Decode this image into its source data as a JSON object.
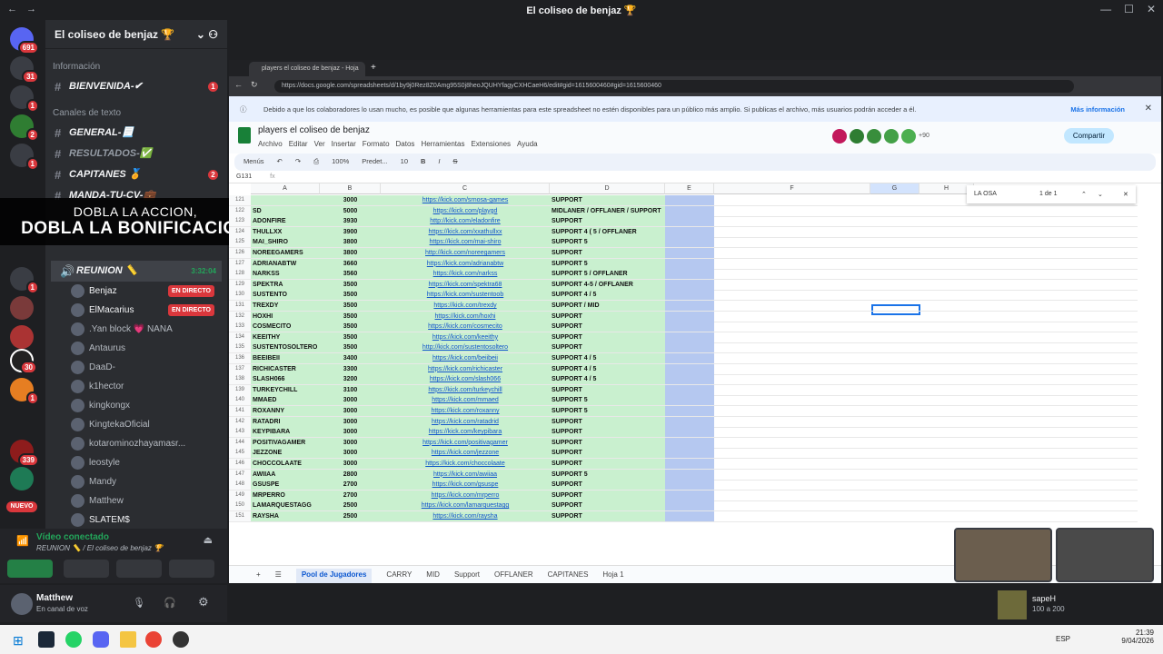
{
  "window": {
    "title": "El coliseo de benjaz 🏆"
  },
  "servers": {
    "badges": [
      "691",
      "31",
      "1",
      "2",
      "1",
      "1",
      "339",
      "30",
      "1"
    ],
    "new_label": "NUEVO"
  },
  "server": {
    "name": "El coliseo de benjaz 🏆"
  },
  "channels": {
    "cat_info": "Información",
    "cat_text": "Canales de texto",
    "info": [
      {
        "name": "BIENVENIDA-✔",
        "badge": "1"
      }
    ],
    "text": [
      {
        "name": "GENERAL-📃",
        "badge": ""
      },
      {
        "name": "RESULTADOS-✅",
        "badge": ""
      },
      {
        "name": "CAPITANES 🏅",
        "badge": "2"
      },
      {
        "name": "MANDA-TU-CV-💼",
        "badge": ""
      }
    ],
    "voice": {
      "name": "REUNION 📏",
      "time": "3:32:04"
    },
    "members": [
      {
        "name": "Benjaz",
        "live": "EN DIRECTO"
      },
      {
        "name": "ElMacarius",
        "live": "EN DIRECTO"
      },
      {
        "name": ".Yan block 💗 NANA",
        "live": ""
      },
      {
        "name": "Antaurus",
        "live": ""
      },
      {
        "name": "DaaD-",
        "live": ""
      },
      {
        "name": "k1hector",
        "live": ""
      },
      {
        "name": "kingkongx",
        "live": ""
      },
      {
        "name": "KingtekaOficial",
        "live": ""
      },
      {
        "name": "kotarominozhayamasr...",
        "live": ""
      },
      {
        "name": "leostyle",
        "live": ""
      },
      {
        "name": "Mandy",
        "live": ""
      },
      {
        "name": "Matthew",
        "live": ""
      },
      {
        "name": "SLATEM$",
        "live": ""
      }
    ]
  },
  "promo": {
    "line1": "DOBLA LA ACCION,",
    "line2": "DOBLA LA BONIFICACION"
  },
  "voice_status": {
    "title": "Vídeo conectado",
    "subtitle": "REUNION 📏 / El coliseo de benjaz 🏆"
  },
  "user": {
    "name": "Matthew",
    "status": "En canal de voz"
  },
  "browser": {
    "tab": "players el coliseo de benjaz - Hoja",
    "url": "https://docs.google.com/spreadsheets/d/1by9j0Rez8Z0Amg95S0j8heoJQUHYfagyCXHCaeH6/edit#gid=1615600460#gid=1615600460",
    "notice": "Debido a que los colaboradores lo usan mucho, es posible que algunas herramientas para este spreadsheet no estén disponibles para un público más amplio. Si publicas el archivo, más usuarios podrán acceder a él.",
    "notice_link": "Más información",
    "doc_title": "players el coliseo de benjaz",
    "menu": [
      "Archivo",
      "Editar",
      "Ver",
      "Insertar",
      "Formato",
      "Datos",
      "Herramientas",
      "Extensiones",
      "Ayuda"
    ],
    "share": "Compartir",
    "collab_count": "+90",
    "toolbar": {
      "menus": "Menús",
      "zoom": "100%",
      "font": "Predet...",
      "size": "10"
    },
    "cell_ref": "G131",
    "find": {
      "query": "LA OSA",
      "count": "1 de 1"
    },
    "columns": [
      "A",
      "B",
      "C",
      "D",
      "E",
      "F",
      "G",
      "H"
    ],
    "sheets": [
      "Pool de Jugadores",
      "CARRY",
      "MID",
      "Support",
      "OFFLANER",
      "CAPITANES",
      "Hoja 1"
    ]
  },
  "rows": [
    [
      "121",
      "",
      "3000",
      "https://kick.com/srnosa-games",
      "SUPPORT"
    ],
    [
      "122",
      "SD",
      "5000",
      "https://kick.com/playgd",
      "MIDLANER / OFFLANER / SUPPORT"
    ],
    [
      "123",
      "ADONFIRE",
      "3930",
      "http://kick.com/eladonfire",
      "SUPPORT"
    ],
    [
      "124",
      "THULLXX",
      "3900",
      "https://kick.com/xxathullxx",
      "SUPPORT 4 ( 5 / OFFLANER"
    ],
    [
      "125",
      "MAI_SHIRO",
      "3800",
      "https://kick.com/mai-shiro",
      "SUPPORT 5"
    ],
    [
      "126",
      "NOREEGAMERS",
      "3800",
      "http://kick.com/noreegamers",
      "SUPPORT"
    ],
    [
      "127",
      "ADRIANABTW",
      "3660",
      "https://kick.com/adrianabtw",
      "SUPPORT 5"
    ],
    [
      "128",
      "NARKSS",
      "3560",
      "https://kick.com/narkss",
      "SUPPORT 5 / OFFLANER"
    ],
    [
      "129",
      "SPEKTRA",
      "3500",
      "https://kick.com/spektra68",
      "SUPPORT 4-5 / OFFLANER"
    ],
    [
      "130",
      "SUSTENTO",
      "3500",
      "https://kick.com/sustentoob",
      "SUPPORT 4 / 5"
    ],
    [
      "131",
      "TREXDY",
      "3500",
      "https://kick.com/trexdy",
      "SUPPORT / MID"
    ],
    [
      "132",
      "HOXHI",
      "3500",
      "https://kick.com/hoxhi",
      "SUPPORT"
    ],
    [
      "133",
      "COSMECITO",
      "3500",
      "https://kick.com/cosmecito",
      "SUPPORT"
    ],
    [
      "134",
      "KEEITHY",
      "3500",
      "https://kick.com/keeithy",
      "SUPPORT"
    ],
    [
      "135",
      "SUSTENTOSOLTERO",
      "3500",
      "http://kick.com/sustentosoltero",
      "SUPPORT"
    ],
    [
      "136",
      "BEEIBEII",
      "3400",
      "https://kick.com/beiibeii",
      "SUPPORT 4 / 5"
    ],
    [
      "137",
      "RICHICASTER",
      "3300",
      "https://kick.com/richicaster",
      "SUPPORT 4 / 5"
    ],
    [
      "138",
      "SLASH066",
      "3200",
      "https://kick.com/slash066",
      "SUPPORT 4 / 5"
    ],
    [
      "139",
      "TURKEYCHILL",
      "3100",
      "https://kick.com/turkeychill",
      "SUPPORT"
    ],
    [
      "140",
      "MMAED",
      "3000",
      "https://kick.com/mmaed",
      "SUPPORT 5"
    ],
    [
      "141",
      "ROXANNY",
      "3000",
      "https://kick.com/roxanny",
      "SUPPORT 5"
    ],
    [
      "142",
      "RATADRI",
      "3000",
      "https://kick.com/ratadrid",
      "SUPPORT"
    ],
    [
      "143",
      "KEYPIBARA",
      "3000",
      "https://kick.com/keypibara",
      "SUPPORT"
    ],
    [
      "144",
      "POSITIVAGAMER",
      "3000",
      "https://kick.com/positivagamer",
      "SUPPORT"
    ],
    [
      "145",
      "JEZZONE",
      "3000",
      "https://kick.com/jezzone",
      "SUPPORT"
    ],
    [
      "146",
      "CHOCCOLAATE",
      "3000",
      "https://kick.com/choccolaate",
      "SUPPORT"
    ],
    [
      "147",
      "AWIIAA",
      "2800",
      "https://kick.com/awiiaa",
      "SUPPORT 5"
    ],
    [
      "148",
      "GSUSPE",
      "2700",
      "https://kick.com/gsuspe",
      "SUPPORT"
    ],
    [
      "149",
      "MRPERRO",
      "2700",
      "https://kick.com/mrperro",
      "SUPPORT"
    ],
    [
      "150",
      "LAMARQUESTAGG",
      "2500",
      "https://kick.com/lamarquestagg",
      "SUPPORT"
    ],
    [
      "151",
      "RAYSHA",
      "2500",
      "https://kick.com/raysha",
      "SUPPORT"
    ]
  ],
  "stream": {
    "name": "sapeH",
    "viewers": "100 a 200"
  },
  "taskbar": {
    "time": "21:39",
    "date": "9/04/2026",
    "lang": "ESP"
  }
}
